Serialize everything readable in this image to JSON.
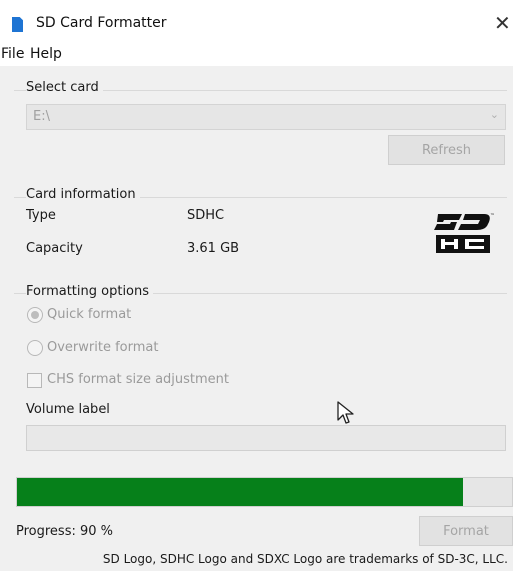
{
  "window": {
    "title": "SD Card Formatter",
    "close_glyph": "✕",
    "icon": "sd-card-icon"
  },
  "menu": {
    "items": [
      {
        "label": "File"
      },
      {
        "label": "Help"
      }
    ]
  },
  "select_card": {
    "group_label": "Select card",
    "selected_value": "E:\\",
    "refresh_label": "Refresh"
  },
  "card_information": {
    "group_label": "Card information",
    "type_label": "Type",
    "type_value": "SDHC",
    "capacity_label": "Capacity",
    "capacity_value": "3.61 GB",
    "logo": "sdhc-logo"
  },
  "formatting_options": {
    "group_label": "Formatting options",
    "quick_format_label": "Quick format",
    "quick_format_selected": true,
    "overwrite_format_label": "Overwrite format",
    "overwrite_format_selected": false,
    "chs_label": "CHS format size adjustment",
    "chs_checked": false,
    "volume_label_caption": "Volume label",
    "volume_label_value": ""
  },
  "progress": {
    "fraction": 0.9,
    "text": "Progress: 90 %",
    "fill_color": "#06801a"
  },
  "format_button": {
    "label": "Format"
  },
  "footer": {
    "text": "SD Logo, SDHC Logo and SDXC Logo are trademarks of SD-3C, LLC."
  }
}
